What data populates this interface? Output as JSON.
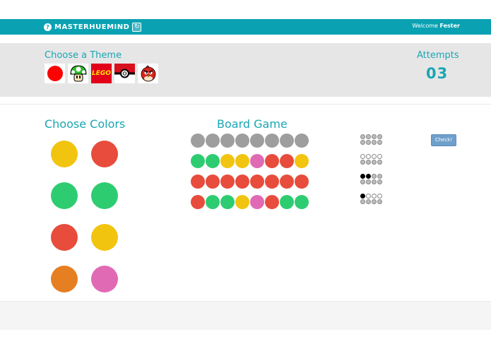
{
  "navbar": {
    "brand_icon": "?",
    "brand": "MASTERHUEMIND",
    "brand_logo_icon": "swirl-icon",
    "welcome_prefix": "Welcome ",
    "user": "Fester"
  },
  "theme": {
    "title": "Choose a Theme",
    "options": [
      {
        "name": "solid-colors-theme",
        "icon": "red-circle"
      },
      {
        "name": "mushroom-theme",
        "icon": "mario-mushroom"
      },
      {
        "name": "lego-theme",
        "label": "LEGO"
      },
      {
        "name": "pokeball-theme",
        "icon": "pokeball"
      },
      {
        "name": "angry-birds-theme",
        "icon": "angry-bird"
      }
    ]
  },
  "attempts": {
    "label": "Attempts",
    "value": "03"
  },
  "colors": {
    "title": "Choose Colors",
    "palette": [
      "#f1c40f",
      "#e74c3c",
      "#2ecc71",
      "#2ecc71",
      "#e74c3c",
      "#f1c40f",
      "#e67e22",
      "#e06ab4"
    ]
  },
  "board": {
    "title": "Board Game",
    "rows": [
      [
        "#9e9e9e",
        "#9e9e9e",
        "#9e9e9e",
        "#9e9e9e",
        "#9e9e9e",
        "#9e9e9e",
        "#9e9e9e",
        "#9e9e9e"
      ],
      [
        "#2ecc71",
        "#2ecc71",
        "#f1c40f",
        "#f1c40f",
        "#e06ab4",
        "#e74c3c",
        "#e74c3c",
        "#f1c40f"
      ],
      [
        "#e74c3c",
        "#e74c3c",
        "#e74c3c",
        "#e74c3c",
        "#e74c3c",
        "#e74c3c",
        "#e74c3c",
        "#e74c3c"
      ],
      [
        "#e74c3c",
        "#2ecc71",
        "#2ecc71",
        "#f1c40f",
        "#e06ab4",
        "#e74c3c",
        "#2ecc71",
        "#2ecc71"
      ]
    ],
    "feedback": [
      [
        "gray",
        "gray",
        "gray",
        "gray",
        "gray",
        "gray",
        "gray",
        "gray"
      ],
      [
        "white",
        "white",
        "white",
        "white",
        "gray",
        "gray",
        "gray",
        "gray"
      ],
      [
        "black",
        "black",
        "gray",
        "gray",
        "gray",
        "gray",
        "gray",
        "gray"
      ],
      [
        "black",
        "white",
        "white",
        "white",
        "gray",
        "gray",
        "gray",
        "gray"
      ]
    ],
    "check_label": "Check!"
  }
}
